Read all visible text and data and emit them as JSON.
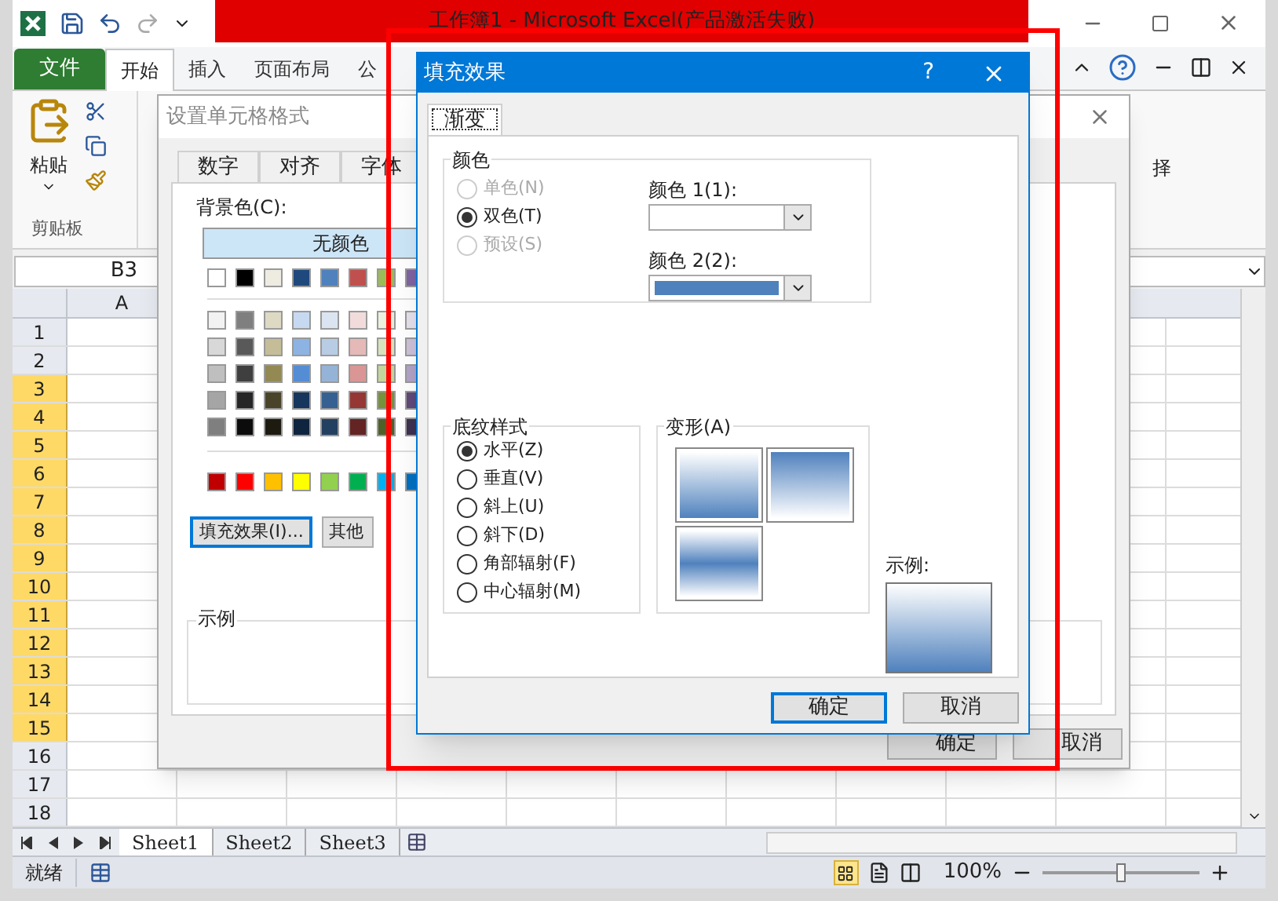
{
  "excel": {
    "title": "工作簿1 - Microsoft Excel(产品激活失败)",
    "tabs": [
      {
        "label": "文件",
        "kind": "file",
        "selected": false
      },
      {
        "label": "开始",
        "kind": "tab",
        "selected": true
      },
      {
        "label": "插入",
        "kind": "tab",
        "selected": false
      },
      {
        "label": "页面布局",
        "kind": "tab",
        "selected": false
      },
      {
        "label": "公",
        "kind": "tab",
        "selected": false
      }
    ],
    "paste_label": "粘贴",
    "clipboard_group": "剪贴板",
    "ribbon_fragment": "择",
    "name_box": "B3",
    "column": "A",
    "rows": [
      {
        "label": "1",
        "selected": false
      },
      {
        "label": "2",
        "selected": false
      },
      {
        "label": "3",
        "selected": true
      },
      {
        "label": "4",
        "selected": true
      },
      {
        "label": "5",
        "selected": true
      },
      {
        "label": "6",
        "selected": true
      },
      {
        "label": "7",
        "selected": true
      },
      {
        "label": "8",
        "selected": true
      },
      {
        "label": "9",
        "selected": true
      },
      {
        "label": "10",
        "selected": true
      },
      {
        "label": "11",
        "selected": true
      },
      {
        "label": "12",
        "selected": true
      },
      {
        "label": "13",
        "selected": true
      },
      {
        "label": "14",
        "selected": true
      },
      {
        "label": "15",
        "selected": true
      },
      {
        "label": "16",
        "selected": false
      },
      {
        "label": "17",
        "selected": false
      },
      {
        "label": "18",
        "selected": false
      }
    ],
    "sheets": [
      {
        "label": "Sheet1",
        "selected": true
      },
      {
        "label": "Sheet2",
        "selected": false
      },
      {
        "label": "Sheet3",
        "selected": false
      }
    ],
    "status": "就绪",
    "zoom": "100%",
    "zoom_slider": {
      "level": 0.5
    }
  },
  "format_dialog": {
    "title": "设置单元格格式",
    "tabs": [
      {
        "label": "数字"
      },
      {
        "label": "对齐"
      },
      {
        "label": "字体"
      }
    ],
    "background_label": "背景色(C):",
    "no_color": "无颜色",
    "palette": [
      {
        "swatches": [
          {
            "color": "#ffffff"
          },
          {
            "color": "#000000"
          },
          {
            "color": "#eeece1"
          },
          {
            "color": "#1f497d"
          },
          {
            "color": "#4f81bd"
          },
          {
            "color": "#c0504d"
          },
          {
            "color": "#9bbb59"
          },
          {
            "color": "#8064a2"
          }
        ]
      },
      {
        "swatches": [
          {
            "color": "#f2f2f2"
          },
          {
            "color": "#7f7f7f"
          },
          {
            "color": "#ddd9c3"
          },
          {
            "color": "#c6d9f0"
          },
          {
            "color": "#dbe5f1"
          },
          {
            "color": "#f2dcdb"
          },
          {
            "color": "#ebf1dd"
          },
          {
            "color": "#e5e0ec"
          }
        ]
      },
      {
        "swatches": [
          {
            "color": "#d8d8d8"
          },
          {
            "color": "#595959"
          },
          {
            "color": "#c4bd97"
          },
          {
            "color": "#8db3e2"
          },
          {
            "color": "#b8cce4"
          },
          {
            "color": "#e5b9b7"
          },
          {
            "color": "#d7e3bc"
          },
          {
            "color": "#ccc1d9"
          }
        ]
      },
      {
        "swatches": [
          {
            "color": "#bfbfbf"
          },
          {
            "color": "#3f3f3f"
          },
          {
            "color": "#938953"
          },
          {
            "color": "#548dd4"
          },
          {
            "color": "#95b3d7"
          },
          {
            "color": "#d99694"
          },
          {
            "color": "#c3d69b"
          },
          {
            "color": "#b2a2c7"
          }
        ]
      },
      {
        "swatches": [
          {
            "color": "#a5a5a5"
          },
          {
            "color": "#262626"
          },
          {
            "color": "#494429"
          },
          {
            "color": "#17365d"
          },
          {
            "color": "#366092"
          },
          {
            "color": "#953734"
          },
          {
            "color": "#76923c"
          },
          {
            "color": "#5f497a"
          }
        ]
      },
      {
        "swatches": [
          {
            "color": "#7f7f7f"
          },
          {
            "color": "#0c0c0c"
          },
          {
            "color": "#1d1b10"
          },
          {
            "color": "#0f243e"
          },
          {
            "color": "#244061"
          },
          {
            "color": "#632423"
          },
          {
            "color": "#4f6128"
          },
          {
            "color": "#3f3151"
          }
        ]
      }
    ],
    "standard_colors": [
      {
        "color": "#c00000"
      },
      {
        "color": "#ff0000"
      },
      {
        "color": "#ffc000"
      },
      {
        "color": "#ffff00"
      },
      {
        "color": "#92d050"
      },
      {
        "color": "#00b050"
      },
      {
        "color": "#00b0f0"
      },
      {
        "color": "#0070c0"
      }
    ],
    "fill_effects_button": "填充效果(I)...",
    "more_colors_button": "其他",
    "sample_label": "示例",
    "buttons": [
      {
        "label": "确定"
      },
      {
        "label": "取消"
      }
    ]
  },
  "fill_dialog": {
    "title": "填充效果",
    "help": "?",
    "tabs": [
      {
        "label": "渐变",
        "selected": true
      }
    ],
    "colors_group": "颜色",
    "color_options": [
      {
        "label": "单色(N)",
        "selected": false,
        "disabled": true
      },
      {
        "label": "双色(T)",
        "selected": true,
        "disabled": false
      },
      {
        "label": "预设(S)",
        "selected": false,
        "disabled": true
      }
    ],
    "color1": {
      "label": "颜色 1(1):",
      "color": "#ffffff"
    },
    "color2": {
      "label": "颜色 2(2):",
      "color": "#4f81bd"
    },
    "shading_group": "底纹样式",
    "shading_options": [
      {
        "label": "水平(Z)",
        "selected": true
      },
      {
        "label": "垂直(V)",
        "selected": false
      },
      {
        "label": "斜上(U)",
        "selected": false
      },
      {
        "label": "斜下(D)",
        "selected": false
      },
      {
        "label": "角部辐射(F)",
        "selected": false
      },
      {
        "label": "中心辐射(M)",
        "selected": false
      }
    ],
    "variants_group": "变形(A)",
    "variants": [
      {
        "kind": "fade-down"
      },
      {
        "kind": "fade-up"
      },
      {
        "kind": "band"
      }
    ],
    "sample_label": "示例:",
    "buttons": [
      {
        "label": "确定",
        "focused": true
      },
      {
        "label": "取消",
        "focused": false
      }
    ]
  }
}
